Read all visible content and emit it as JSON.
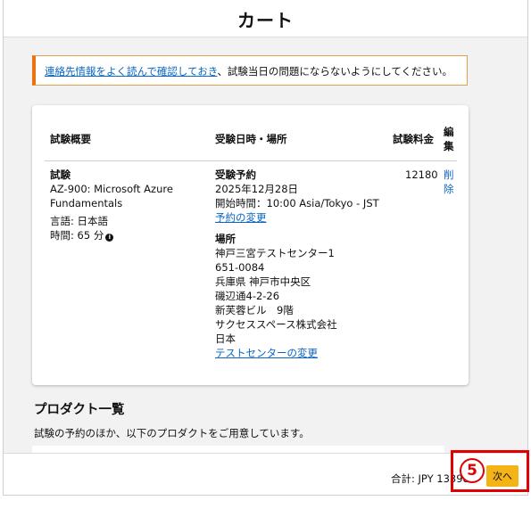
{
  "header": {
    "title": "カート"
  },
  "notice": {
    "link_text": "連絡先情報をよく読んで確認しておき",
    "text": "、試験当日の問題にならないようにしてください。"
  },
  "cart": {
    "columns": {
      "summary": "試験概要",
      "datetime_place": "受験日時・場所",
      "fee": "試験料金",
      "edit_line1": "編",
      "edit_line2": "集"
    },
    "exam": {
      "label": "試験",
      "name_line1": "AZ-900: Microsoft Azure",
      "name_line2": "Fundamentals",
      "language": "言語: 日本語",
      "duration": "時間: 65 分"
    },
    "appointment": {
      "label": "受験予約",
      "date": "2025年12月28日",
      "start": "開始時間：10:00 Asia/Tokyo - JST",
      "change_link": "予約の変更"
    },
    "location": {
      "label": "場所",
      "lines": [
        "神戸三宮テストセンター1",
        "651-0084",
        "兵庫県 神戸市中央区",
        "磯辺通4-2-26",
        "新芙蓉ビル　9階",
        "サクセススペース株式会社",
        "日本"
      ],
      "change_link": "テストセンターの変更"
    },
    "fee": "12180",
    "delete_line1": "削",
    "delete_line2": "除"
  },
  "products": {
    "title": "プロダクト一覧",
    "description": "試験の予約のほか、以下のプロダクトをご用意しています。"
  },
  "footer": {
    "total": "合計: JPY 13398",
    "next_label": "次へ",
    "step_marker": "5"
  },
  "icons": {
    "info": "info-icon"
  },
  "colors": {
    "accent": "#ec7211",
    "link": "#0a66c2",
    "button": "#f5b416",
    "highlight": "#e00000"
  }
}
